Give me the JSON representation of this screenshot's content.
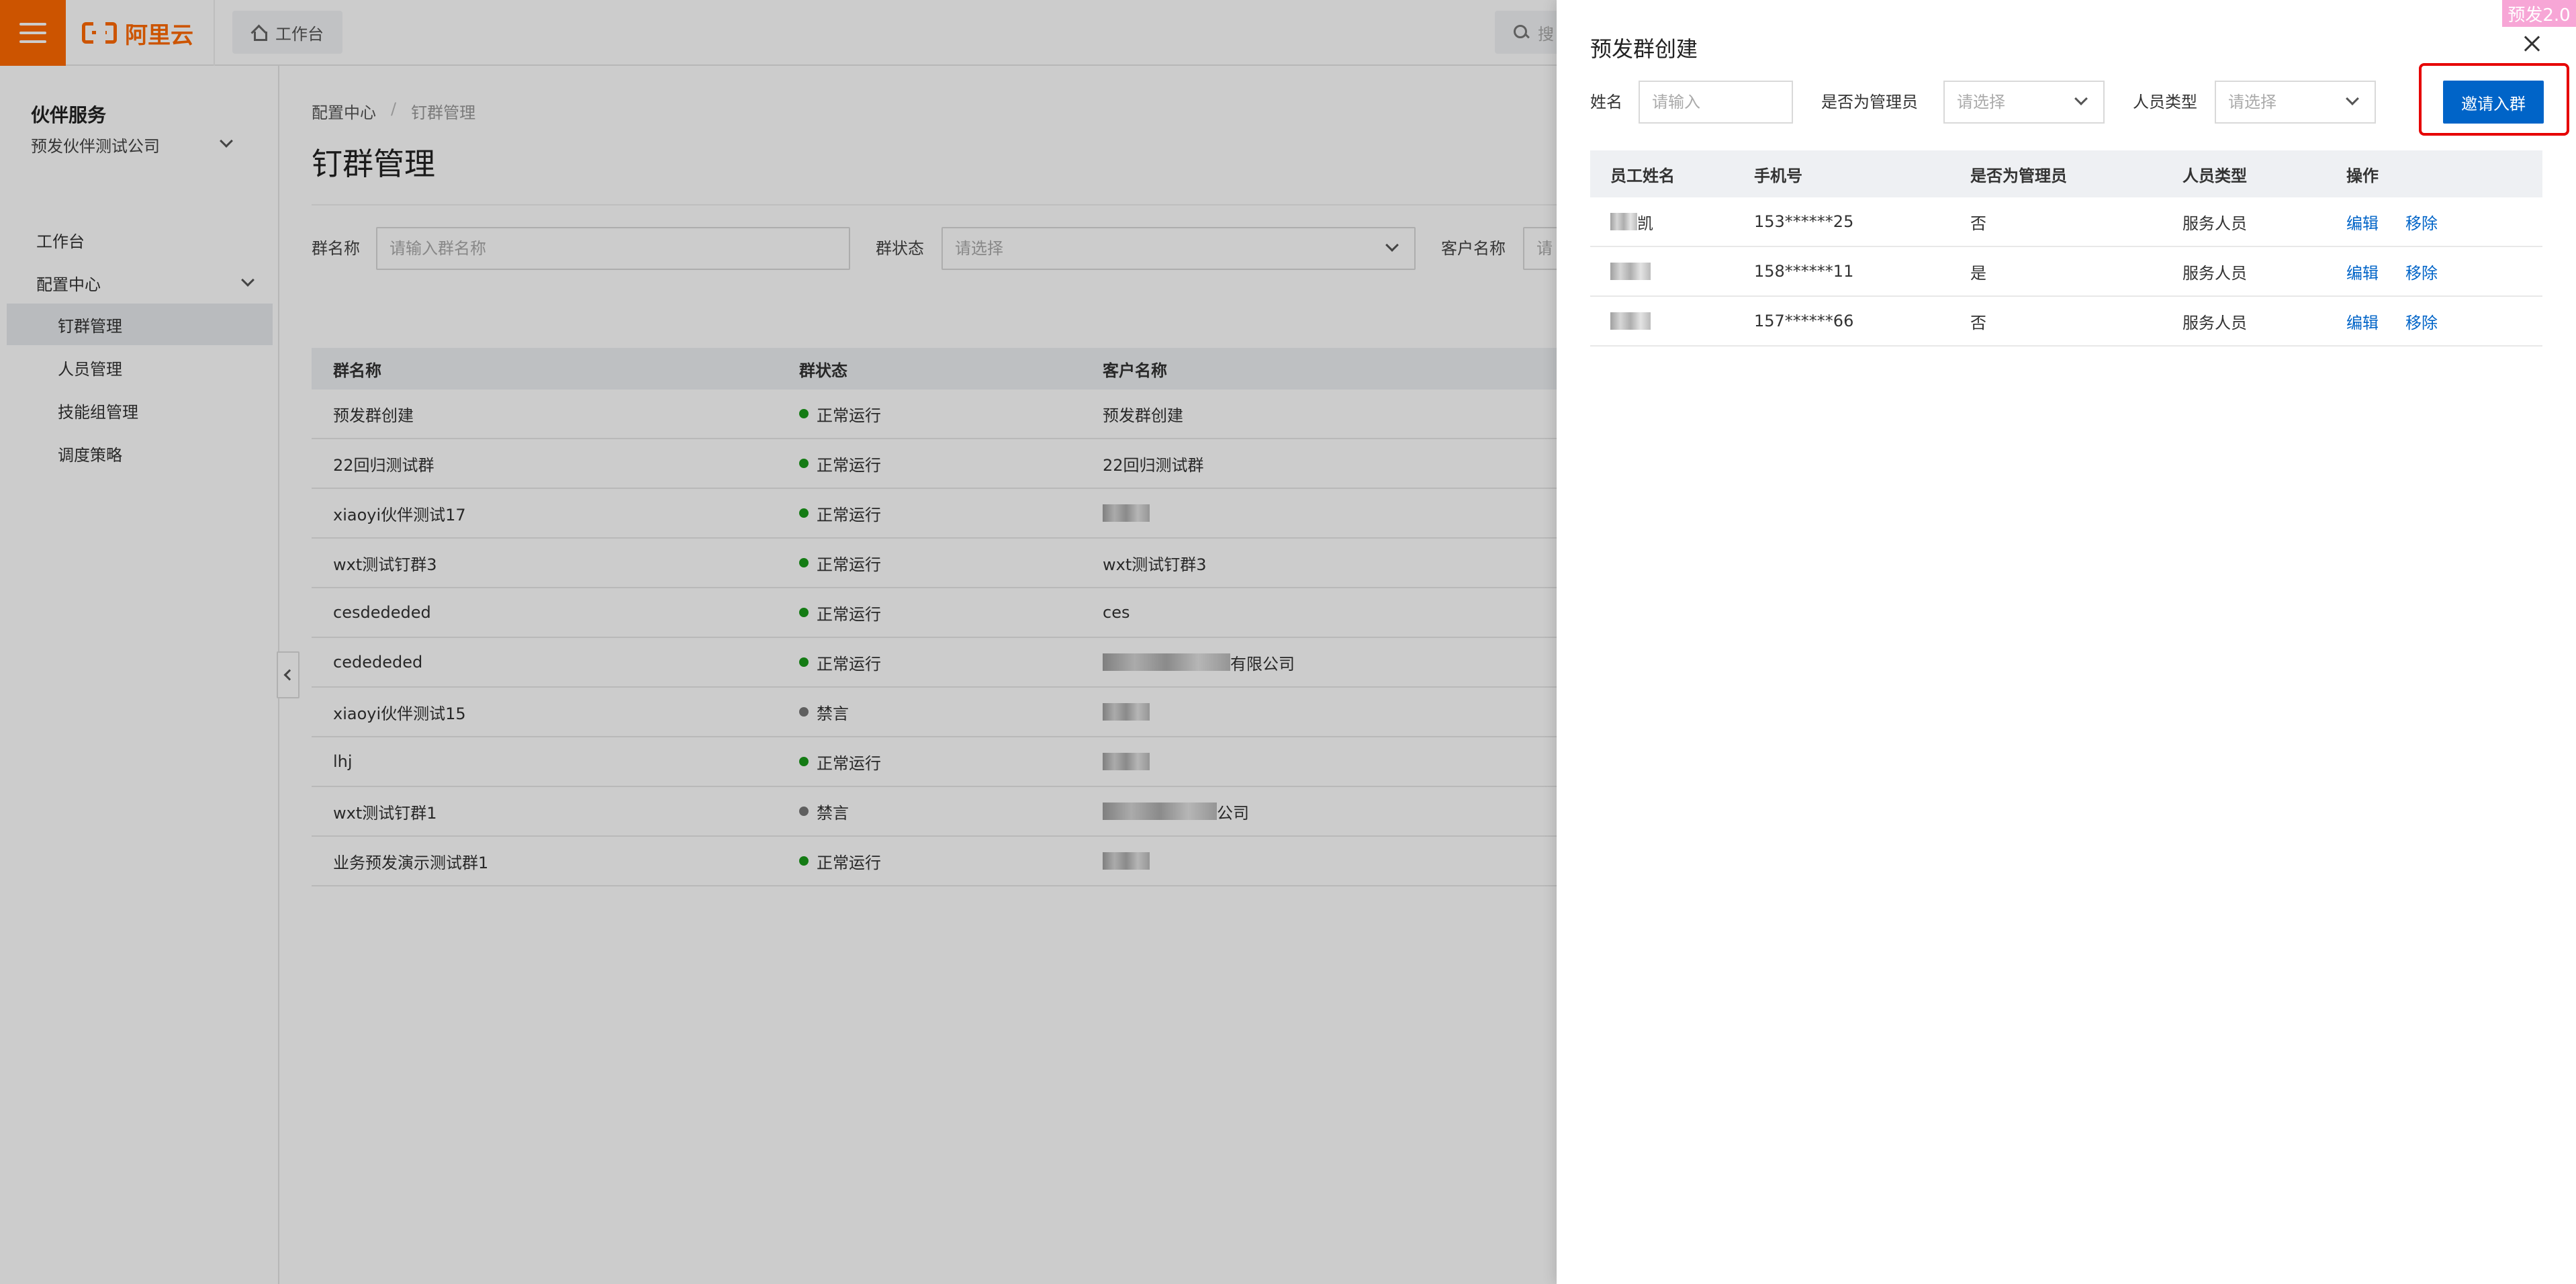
{
  "topbar": {
    "logo_text": "阿里云",
    "workspace_tab": "工作台",
    "search_placeholder": "搜"
  },
  "sidebar": {
    "title": "伙伴服务",
    "company": "预发伙伴测试公司",
    "items": [
      {
        "label": "工作台"
      },
      {
        "label": "配置中心"
      },
      {
        "label": "钉群管理"
      },
      {
        "label": "人员管理"
      },
      {
        "label": "技能组管理"
      },
      {
        "label": "调度策略"
      }
    ]
  },
  "main": {
    "breadcrumb": {
      "parent": "配置中心",
      "separator": "/",
      "current": "钉群管理"
    },
    "title": "钉群管理",
    "filters": {
      "group_name_label": "群名称",
      "group_name_placeholder": "请输入群名称",
      "status_label": "群状态",
      "status_placeholder": "请选择",
      "customer_label": "客户名称",
      "customer_placeholder": "请"
    },
    "table": {
      "headers": [
        "群名称",
        "群状态",
        "客户名称"
      ],
      "rows": [
        {
          "name": "预发群创建",
          "status": "正常运行",
          "customer": "预发群创建"
        },
        {
          "name": "22回归测试群",
          "status": "正常运行",
          "customer": "22回归测试群"
        },
        {
          "name": "xiaoyi伙伴测试17",
          "status": "正常运行",
          "customer": ""
        },
        {
          "name": "wxt测试钉群3",
          "status": "正常运行",
          "customer": "wxt测试钉群3"
        },
        {
          "name": "cesdededed",
          "status": "正常运行",
          "customer": "ces"
        },
        {
          "name": "cedededed",
          "status": "正常运行",
          "customer": "有限公司"
        },
        {
          "name": "xiaoyi伙伴测试15",
          "status": "禁言",
          "customer": ""
        },
        {
          "name": "lhj",
          "status": "正常运行",
          "customer": ""
        },
        {
          "name": "wxt测试钉群1",
          "status": "禁言",
          "customer": "公司"
        },
        {
          "name": "业务预发演示测试群1",
          "status": "正常运行",
          "customer": ""
        }
      ]
    }
  },
  "colors": {
    "accent": "#ff6a00",
    "primary": "#0064c8",
    "running": "#1a9a1a",
    "muted": "#777777",
    "highlight": "#e60000",
    "env_badge": "#f7a6d6"
  },
  "drawer": {
    "title": "预发群创建",
    "env_badge": "预发2.0",
    "filters": {
      "name_label": "姓名",
      "name_placeholder": "请输入",
      "admin_label": "是否为管理员",
      "admin_placeholder": "请选择",
      "type_label": "人员类型",
      "type_placeholder": "请选择"
    },
    "invite_button": "邀请入群",
    "table": {
      "headers": [
        "员工姓名",
        "手机号",
        "是否为管理员",
        "人员类型",
        "操作"
      ],
      "rows": [
        {
          "name": "凯",
          "phone": "153******25",
          "is_admin": "否",
          "type": "服务人员",
          "edit": "编辑",
          "remove": "移除"
        },
        {
          "name": "",
          "phone": "158******11",
          "is_admin": "是",
          "type": "服务人员",
          "edit": "编辑",
          "remove": "移除"
        },
        {
          "name": "",
          "phone": "157******66",
          "is_admin": "否",
          "type": "服务人员",
          "edit": "编辑",
          "remove": "移除"
        }
      ]
    }
  }
}
